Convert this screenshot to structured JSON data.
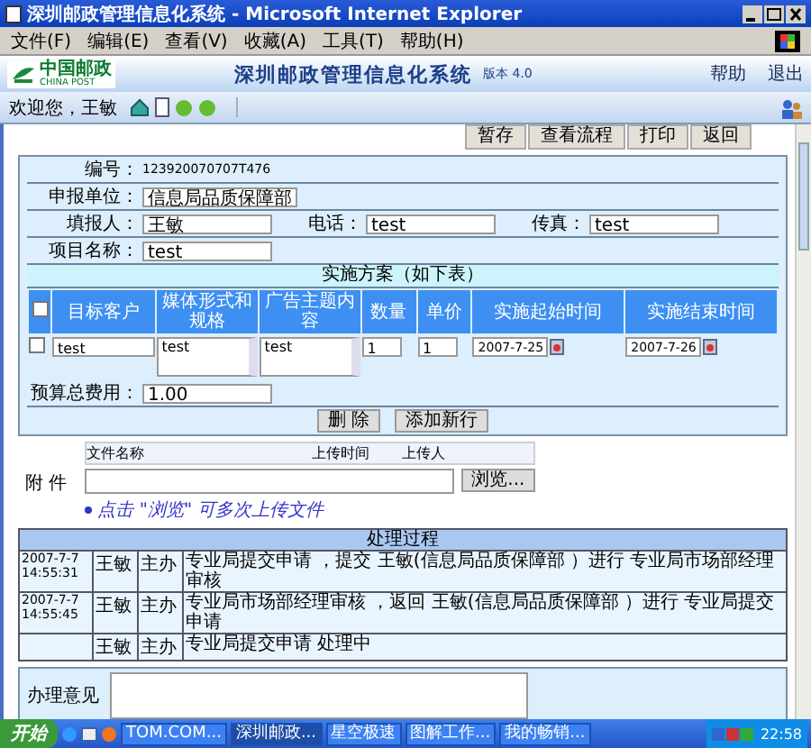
{
  "window": {
    "title": "深圳邮政管理信息化系统 - Microsoft Internet Explorer"
  },
  "menu": [
    "文件(F)",
    "编辑(E)",
    "查看(V)",
    "收藏(A)",
    "工具(T)",
    "帮助(H)"
  ],
  "header": {
    "logo_cn": "中国邮政",
    "logo_en": "CHINA POST",
    "system_title": "深圳邮政管理信息化系统",
    "version": "版本 4.0",
    "links": [
      "帮助",
      "退出"
    ]
  },
  "toolbar": {
    "welcome": "欢迎您，王敏"
  },
  "actions": [
    "暂存",
    "查看流程",
    "打印",
    "返回"
  ],
  "form": {
    "number_label": "编号：",
    "number": "123920070707T476",
    "rows": [
      [
        {
          "label": "申报单位：",
          "value": "信息局品质保障部"
        }
      ],
      [
        {
          "label": "填报人：",
          "value": "王敏"
        },
        {
          "label": "电话：",
          "value": "test"
        },
        {
          "label": "传真：",
          "value": "test"
        }
      ],
      [
        {
          "label": "项目名称：",
          "value": "test"
        }
      ]
    ]
  },
  "plan": {
    "title": "实施方案（如下表）",
    "header_checked": false,
    "columns": [
      {
        "label": "目标客户",
        "kind": "input"
      },
      {
        "label": "媒体形式和规格",
        "kind": "textarea"
      },
      {
        "label": "广告主题内容",
        "kind": "textarea"
      },
      {
        "label": "数量",
        "kind": "small"
      },
      {
        "label": "单价",
        "kind": "small"
      },
      {
        "label": "实施起始时间",
        "kind": "date"
      },
      {
        "label": "实施结束时间",
        "kind": "date"
      }
    ],
    "rows": [
      {
        "checked": false,
        "cells": [
          "test",
          "test",
          "test",
          "1",
          "1",
          "2007-7-25",
          "2007-7-26"
        ]
      }
    ],
    "budget": {
      "label": "预算总费用：",
      "value": "1.00"
    },
    "buttons": [
      "删 除",
      "添加新行"
    ]
  },
  "attachments": {
    "label": "附 件",
    "columns": [
      "文件名称",
      "上传时间",
      "上传人"
    ],
    "browse": "浏览...",
    "hint": "点击 \"浏览\" 可多次上传文件"
  },
  "process": {
    "title": "处理过程",
    "rows": [
      {
        "time": "2007-7-7 14:55:31",
        "person": "王敏",
        "role": "主办",
        "text": "专业局提交申请 ，提交 王敏(信息局品质保障部 ）进行 专业局市场部经理审核"
      },
      {
        "time": "2007-7-7 14:55:45",
        "person": "王敏",
        "role": "主办",
        "text": "专业局市场部经理审核 ，返回 王敏(信息局品质保障部 ）进行 专业局提交申请"
      },
      {
        "person": "王敏",
        "role": "主办",
        "text": "专业局提交申请 处理中"
      }
    ]
  },
  "opinion": {
    "label": "办理意见"
  },
  "taskbar": {
    "start": "开始",
    "items": [
      {
        "label": "TOM.COM...",
        "selected": false
      },
      {
        "label": "深圳邮政...",
        "selected": true
      },
      {
        "label": "星空极速",
        "selected": false
      },
      {
        "label": "图解工作...",
        "selected": false
      },
      {
        "label": "我的畅销...",
        "selected": false
      }
    ],
    "clock": "22:58"
  }
}
